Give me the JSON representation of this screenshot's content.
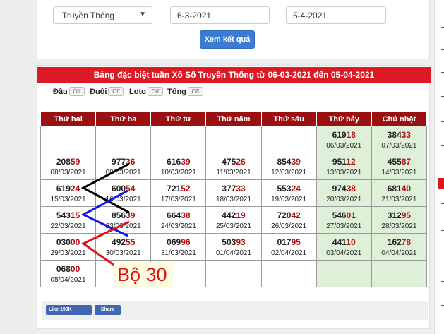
{
  "form": {
    "lottery_select": "Truyền Thống",
    "date_from": "6-3-2021",
    "date_to": "5-4-2021",
    "submit_label": "Xem kết quả"
  },
  "board": {
    "title": "Bảng đặc biệt tuần Xổ Số Truyền Thống từ 06-03-2021 đến 05-04-2021",
    "toggles": [
      {
        "label": "Đầu",
        "state": "Off"
      },
      {
        "label": "Đuôi",
        "state": "Off"
      },
      {
        "label": "Loto",
        "state": "Off"
      },
      {
        "label": "Tổng",
        "state": "Off"
      }
    ],
    "columns": [
      "Thứ hai",
      "Thứ ba",
      "Thứ tư",
      "Thứ năm",
      "Thứ sáu",
      "Thứ bảy",
      "Chủ nhật"
    ],
    "rows": [
      [
        {
          "head": "",
          "tail": "",
          "date": ""
        },
        {
          "head": "",
          "tail": "",
          "date": ""
        },
        {
          "head": "",
          "tail": "",
          "date": ""
        },
        {
          "head": "",
          "tail": "",
          "date": ""
        },
        {
          "head": "",
          "tail": "",
          "date": ""
        },
        {
          "head": "619",
          "tail": "18",
          "date": "06/03/2021"
        },
        {
          "head": "384",
          "tail": "33",
          "date": "07/03/2021"
        }
      ],
      [
        {
          "head": "208",
          "tail": "59",
          "date": "08/03/2021"
        },
        {
          "head": "977",
          "tail": "36",
          "date": "09/03/2021"
        },
        {
          "head": "616",
          "tail": "39",
          "date": "10/03/2021"
        },
        {
          "head": "475",
          "tail": "26",
          "date": "11/03/2021"
        },
        {
          "head": "854",
          "tail": "39",
          "date": "12/03/2021"
        },
        {
          "head": "951",
          "tail": "12",
          "date": "13/03/2021"
        },
        {
          "head": "455",
          "tail": "87",
          "date": "14/03/2021"
        }
      ],
      [
        {
          "head": "619",
          "tail": "24",
          "date": "15/03/2021"
        },
        {
          "head": "600",
          "tail": "54",
          "date": "16/03/2021"
        },
        {
          "head": "721",
          "tail": "52",
          "date": "17/03/2021"
        },
        {
          "head": "377",
          "tail": "33",
          "date": "18/03/2021"
        },
        {
          "head": "553",
          "tail": "24",
          "date": "19/03/2021"
        },
        {
          "head": "974",
          "tail": "38",
          "date": "20/03/2021"
        },
        {
          "head": "681",
          "tail": "40",
          "date": "21/03/2021"
        }
      ],
      [
        {
          "head": "543",
          "tail": "15",
          "date": "22/03/2021"
        },
        {
          "head": "856",
          "tail": "39",
          "date": "23/03/2021"
        },
        {
          "head": "664",
          "tail": "38",
          "date": "24/03/2021"
        },
        {
          "head": "442",
          "tail": "19",
          "date": "25/03/2021"
        },
        {
          "head": "720",
          "tail": "42",
          "date": "26/03/2021"
        },
        {
          "head": "546",
          "tail": "01",
          "date": "27/03/2021"
        },
        {
          "head": "312",
          "tail": "95",
          "date": "28/03/2021"
        }
      ],
      [
        {
          "head": "030",
          "tail": "00",
          "date": "29/03/2021"
        },
        {
          "head": "492",
          "tail": "55",
          "date": "30/03/2021"
        },
        {
          "head": "069",
          "tail": "96",
          "date": "31/03/2021"
        },
        {
          "head": "503",
          "tail": "93",
          "date": "01/04/2021"
        },
        {
          "head": "017",
          "tail": "95",
          "date": "02/04/2021"
        },
        {
          "head": "441",
          "tail": "10",
          "date": "03/04/2021"
        },
        {
          "head": "162",
          "tail": "78",
          "date": "04/04/2021"
        }
      ],
      [
        {
          "head": "068",
          "tail": "00",
          "date": "05/04/2021"
        },
        {
          "head": "",
          "tail": "",
          "date": ""
        },
        {
          "head": "",
          "tail": "",
          "date": ""
        },
        {
          "head": "",
          "tail": "",
          "date": ""
        },
        {
          "head": "",
          "tail": "",
          "date": ""
        },
        {
          "head": "",
          "tail": "",
          "date": ""
        },
        {
          "head": "",
          "tail": "",
          "date": ""
        }
      ]
    ]
  },
  "annotation": {
    "text": "Bộ 30",
    "stroke_colors": {
      "black": "#000000",
      "blue": "#1515e6",
      "red": "#e3121a"
    }
  },
  "social": {
    "like_label": "Like 199K",
    "share_label": "Share"
  },
  "colors": {
    "header_red": "#dd1a23",
    "table_head": "#9b1111",
    "weekend_bg": "#dff0d8",
    "button_blue": "#3a7bd5",
    "tail_digits": "#b40f12"
  }
}
